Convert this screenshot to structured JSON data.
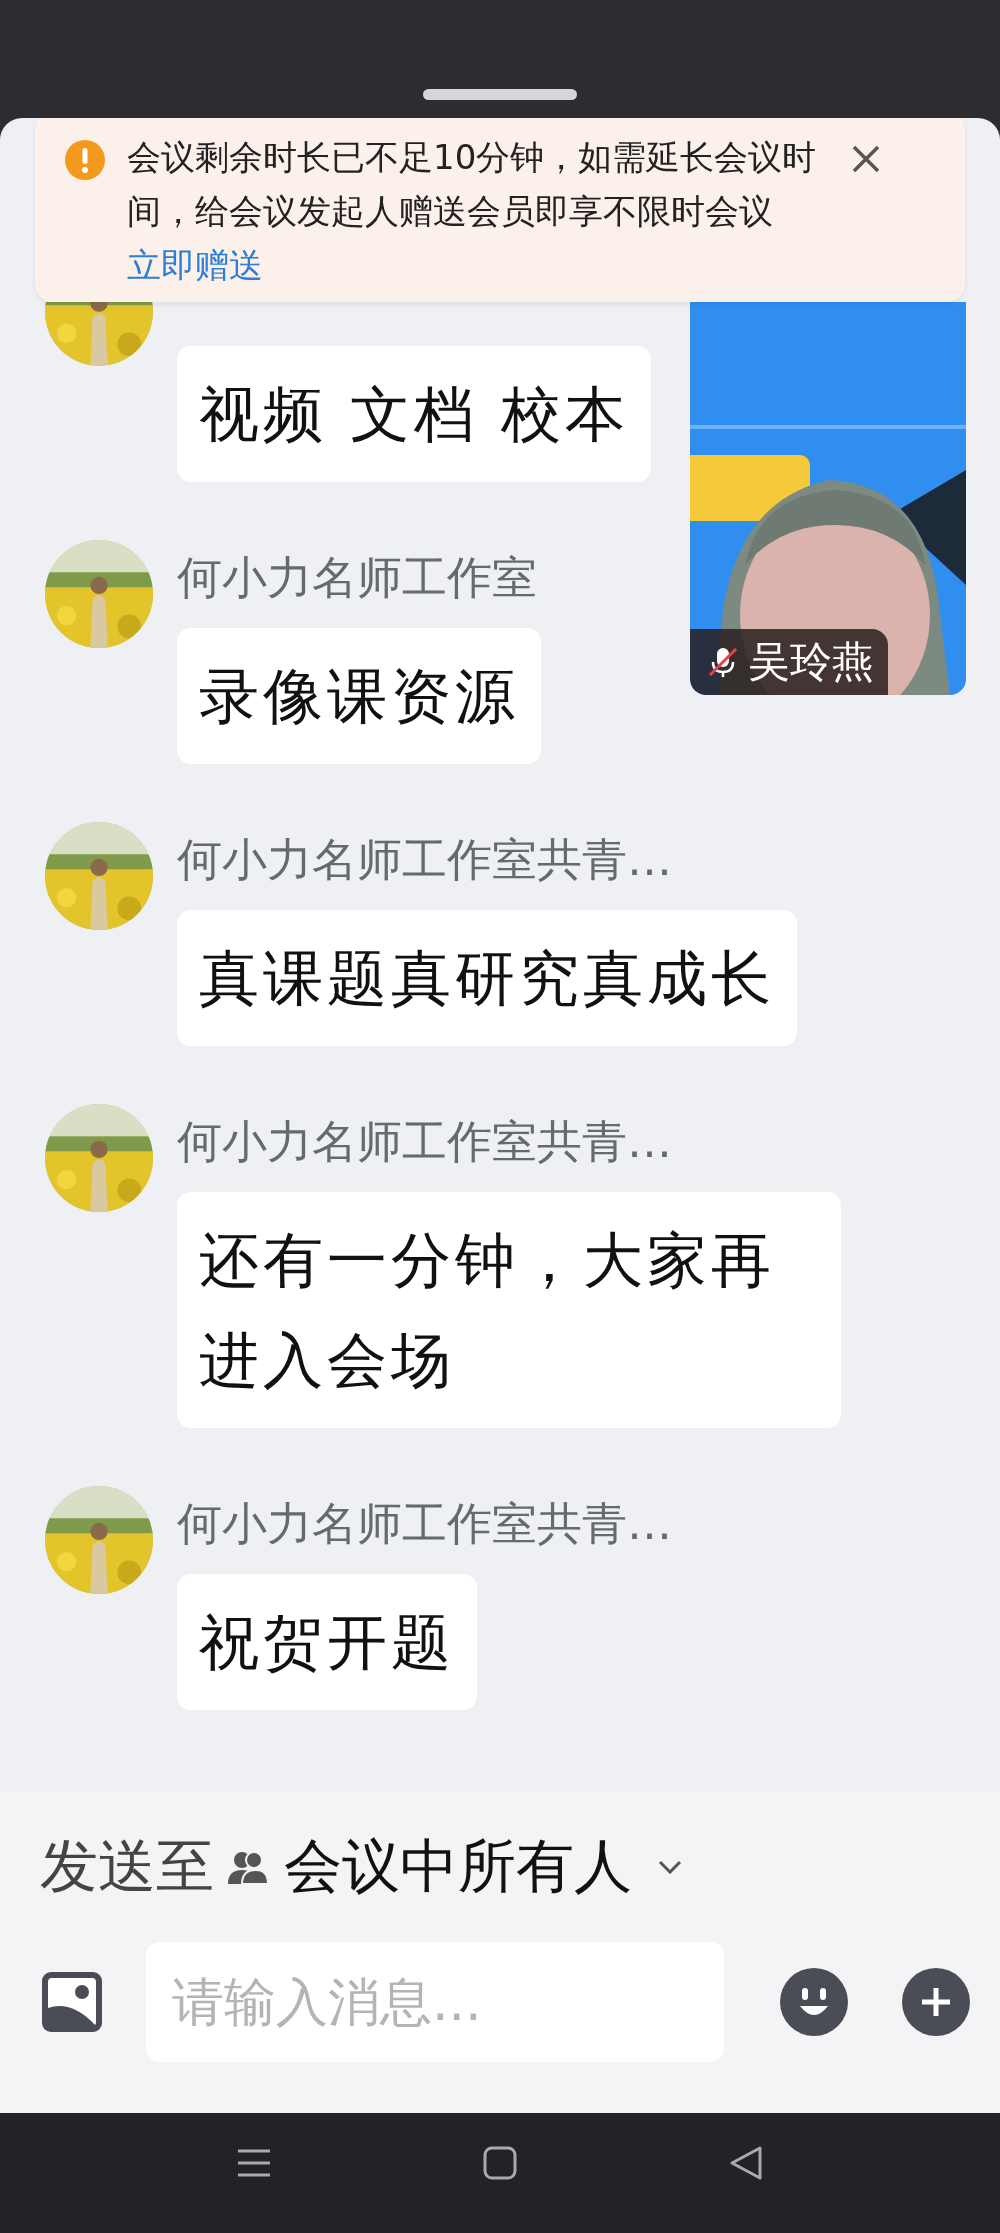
{
  "notice": {
    "text": "会议剩余时长已不足10分钟，如需延长会议时间，给会议发起人赠送会员即享不限时会议",
    "link": "立即赠送"
  },
  "video_tile": {
    "kind": "picture",
    "participant": "吴玲燕",
    "muted": true
  },
  "messages": [
    {
      "text": "视频 文档 校本"
    },
    {
      "sender": "何小力名师工作室",
      "text": "录像课资源"
    },
    {
      "sender": "何小力名师工作室共青…",
      "text": "真课题真研究真成长"
    },
    {
      "sender": "何小力名师工作室共青…",
      "text": "还有一分钟，大家再进入会场"
    },
    {
      "sender": "何小力名师工作室共青…",
      "text": "祝贺开题"
    }
  ],
  "composer": {
    "send_to_label": "发送至",
    "recipient": "会议中所有人",
    "placeholder": "请输入消息..."
  }
}
